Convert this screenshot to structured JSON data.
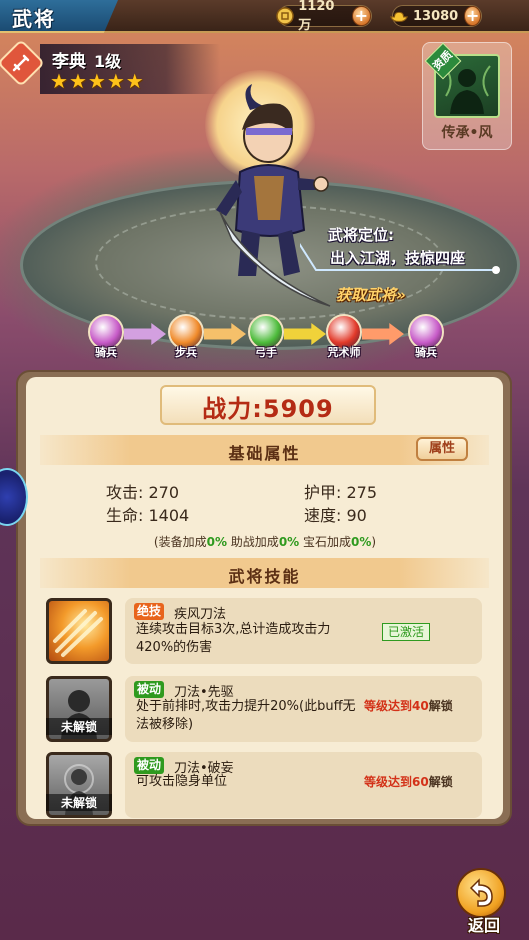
{
  "header": {
    "title": "武将",
    "coins": "1120万",
    "ingots": "13080"
  },
  "hero": {
    "name": "李典",
    "level": "1级",
    "stars": 5,
    "power": "战力:5909",
    "role_label": "武将定位:",
    "role_text": "出入江湖，技惊四座",
    "acquire_label": "获取武将"
  },
  "inheritance": {
    "tag": "资质",
    "label": "传承•风"
  },
  "class_path": [
    {
      "label": "骑兵",
      "color": "#c75bc8"
    },
    {
      "label": "步兵",
      "color": "#f08a2a"
    },
    {
      "label": "弓手",
      "color": "#4cbb3a"
    },
    {
      "label": "咒术师",
      "color": "#e23a2a"
    },
    {
      "label": "骑兵",
      "color": "#c75bc8"
    }
  ],
  "attributes": {
    "section_title": "基础属性",
    "attr_button": "属性",
    "attack_label": "攻击:",
    "attack": "270",
    "armor_label": "护甲:",
    "armor": "275",
    "hp_label": "生命:",
    "hp": "1404",
    "speed_label": "速度:",
    "speed": "90",
    "bonus_open": "(",
    "equip_label": "装备加成",
    "equip_val": "0%",
    "assist_label": "助战加成",
    "assist_val": "0%",
    "gem_label": "宝石加成",
    "gem_val": "0%",
    "bonus_close": ")"
  },
  "skills": {
    "section_title": "武将技能",
    "list": [
      {
        "tag": "绝技",
        "tag_color": "#e8641c",
        "name": "疾风刀法",
        "desc": "连续攻击目标3次,总计造成攻击力420%的伤害",
        "status": "已激活",
        "locked": false
      },
      {
        "tag": "被动",
        "tag_color": "#2f9a1f",
        "name": "刀法•先驱",
        "desc": "处于前排时,攻击力提升20%(此buff无法被移除)",
        "req_prefix": "等级达到",
        "req_level": "40",
        "req_suffix": "解锁",
        "locked_label": "未解锁",
        "locked": true
      },
      {
        "tag": "被动",
        "tag_color": "#2f9a1f",
        "name": "刀法•破妄",
        "desc": "可攻击隐身单位",
        "req_prefix": "等级达到",
        "req_level": "60",
        "req_suffix": "解锁",
        "locked_label": "未解锁",
        "locked": true
      }
    ]
  },
  "footer": {
    "return_label": "返回"
  }
}
